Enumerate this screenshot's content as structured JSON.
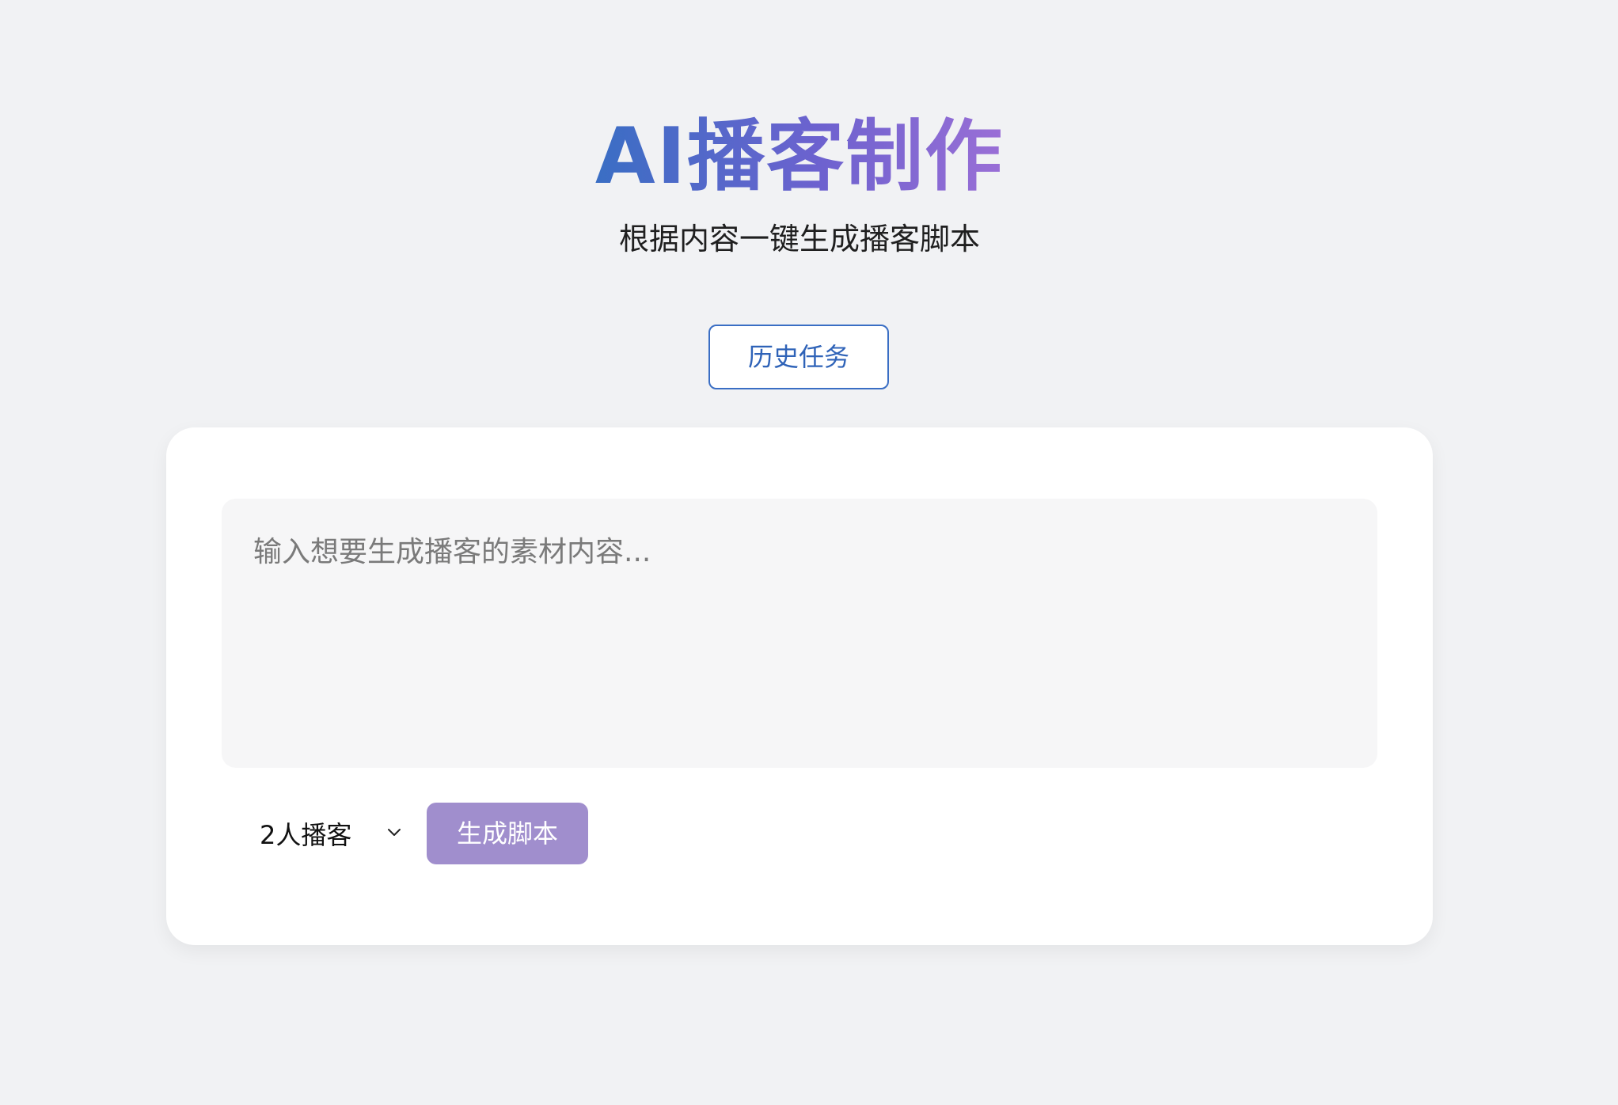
{
  "header": {
    "title": "AI播客制作",
    "subtitle": "根据内容一键生成播客脚本"
  },
  "history_button": {
    "label": "历史任务"
  },
  "form": {
    "content_input": {
      "value": "",
      "placeholder": "输入想要生成播客的素材内容..."
    },
    "speaker_select": {
      "selected": "2人播客",
      "icon": "chevron-down-icon"
    },
    "generate_button": {
      "label": "生成脚本"
    }
  },
  "colors": {
    "background": "#f1f2f4",
    "accent_blue": "#3a6ec4",
    "accent_purple": "#9a6fd6",
    "generate_button_bg": "#a08ecd"
  }
}
